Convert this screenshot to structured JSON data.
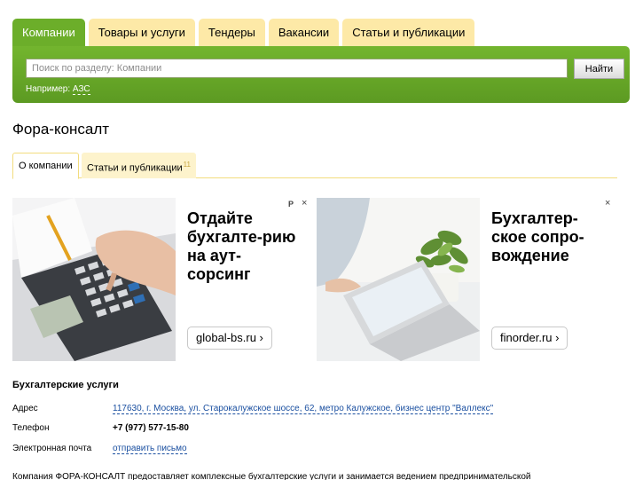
{
  "top_tabs": [
    "Компании",
    "Товары и услуги",
    "Тендеры",
    "Вакансии",
    "Статьи и публикации"
  ],
  "search": {
    "placeholder": "Поиск по разделу: Компании",
    "button": "Найти",
    "example_label": "Например:",
    "example_link": "АЗС"
  },
  "company": {
    "title": "Фора-консалт"
  },
  "sub_tabs": {
    "about": "О компании",
    "articles": "Статьи и публикации",
    "articles_count": "11"
  },
  "ads": [
    {
      "headline": "Отдайте бухгалте-рию на аут-сорсинг",
      "domain": "global-bs.ru ›",
      "mark": "Р",
      "close": "×"
    },
    {
      "headline": "Бухгалтер-ское сопро-вождение",
      "domain": "finorder.ru ›",
      "close": "×"
    }
  ],
  "info": {
    "section_title": "Бухгалтерские услуги",
    "address_label": "Адрес",
    "address_value": "117630, г. Москва, ул. Старокалужское шоссе, 62, метро Калужское, бизнес центр \"Валлекс\"",
    "phone_label": "Телефон",
    "phone_value": "+7 (977) 577-15-80",
    "email_label": "Электронная почта",
    "email_link": "отправить письмо"
  },
  "description": "Компания ФОРА-КОНСАЛТ предоставляет комплексные бухгалтерские услуги и занимается ведением предпринимательской",
  "colors": {
    "green": "#6cae2a",
    "tab_yellow": "#fde9a7",
    "link": "#1a4fa0"
  }
}
